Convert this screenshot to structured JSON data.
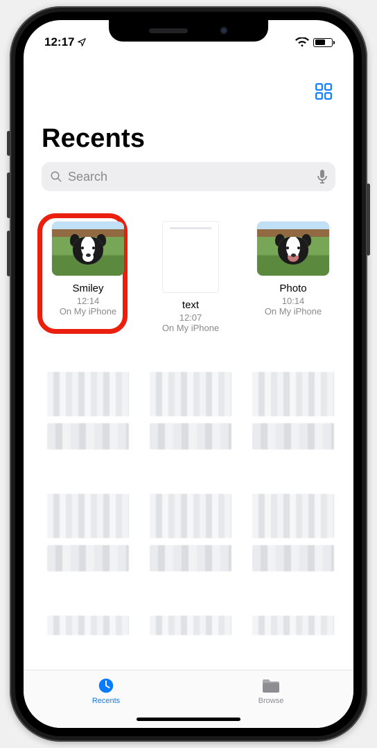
{
  "status": {
    "time": "12:17"
  },
  "header": {
    "title": "Recents"
  },
  "search": {
    "placeholder": "Search"
  },
  "files": [
    {
      "name": "Smiley",
      "time": "12:14",
      "location": "On My iPhone",
      "kind": "image",
      "highlighted": true,
      "mouth": "closed"
    },
    {
      "name": "text",
      "time": "12:07",
      "location": "On My iPhone",
      "kind": "doc",
      "highlighted": false
    },
    {
      "name": "Photo",
      "time": "10:14",
      "location": "On My iPhone",
      "kind": "image",
      "highlighted": false,
      "mouth": "open"
    }
  ],
  "placeholder_rows": 2,
  "tabs": [
    {
      "id": "recents",
      "label": "Recents",
      "active": true
    },
    {
      "id": "browse",
      "label": "Browse",
      "active": false
    }
  ],
  "colors": {
    "accent": "#0a7aff",
    "highlight_ring": "#ea1f0e"
  }
}
